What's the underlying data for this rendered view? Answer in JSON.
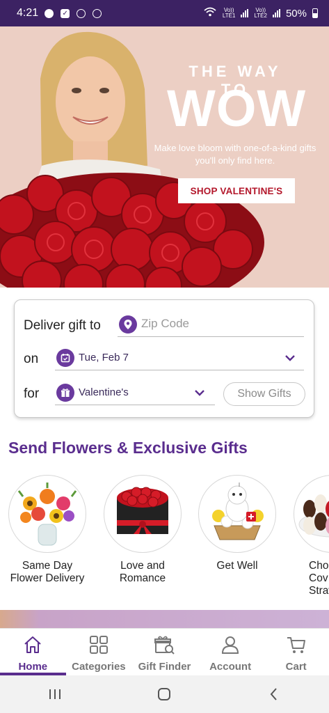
{
  "status_bar": {
    "time": "4:21",
    "network1": "Vo))\nLTE1",
    "network1_top": "Vo))",
    "network1_bottom": "LTE1",
    "network2_top": "Vo))",
    "network2_bottom": "LTE2",
    "battery": "50%",
    "notification_icons": [
      "skype-icon",
      "checkbox-notification-icon",
      "whatsapp-icon",
      "sync-icon"
    ]
  },
  "hero": {
    "eyebrow": "THE WAY TO",
    "title": "WOW",
    "subtitle": "Make love bloom with one-of-a-kind gifts you'll only find here.",
    "cta": "SHOP VALENTINE'S"
  },
  "delivery": {
    "deliver_label": "Deliver gift to",
    "zip_placeholder": "Zip Code",
    "on_label": "on",
    "date_value": "Tue, Feb 7",
    "for_label": "for",
    "occasion_value": "Valentine's",
    "show_gifts": "Show Gifts"
  },
  "section": {
    "title": "Send Flowers & Exclusive Gifts"
  },
  "categories": [
    {
      "line1": "Same Day",
      "line2": "Flower Delivery",
      "line3": ""
    },
    {
      "line1": "Love and",
      "line2": "Romance",
      "line3": ""
    },
    {
      "line1": "Get Well",
      "line2": "",
      "line3": ""
    },
    {
      "line1": "Choc",
      "line2": "Cov",
      "line3": "Straw"
    }
  ],
  "bottom_nav": [
    {
      "label": "Home",
      "icon": "home-icon",
      "active": true
    },
    {
      "label": "Categories",
      "icon": "grid-icon",
      "active": false
    },
    {
      "label": "Gift Finder",
      "icon": "gift-search-icon",
      "active": false
    },
    {
      "label": "Account",
      "icon": "person-icon",
      "active": false
    },
    {
      "label": "Cart",
      "icon": "cart-icon",
      "active": false
    }
  ],
  "colors": {
    "brand_purple": "#5a2d8e",
    "status_bar": "#3c2263",
    "cta_red": "#b3172b"
  }
}
